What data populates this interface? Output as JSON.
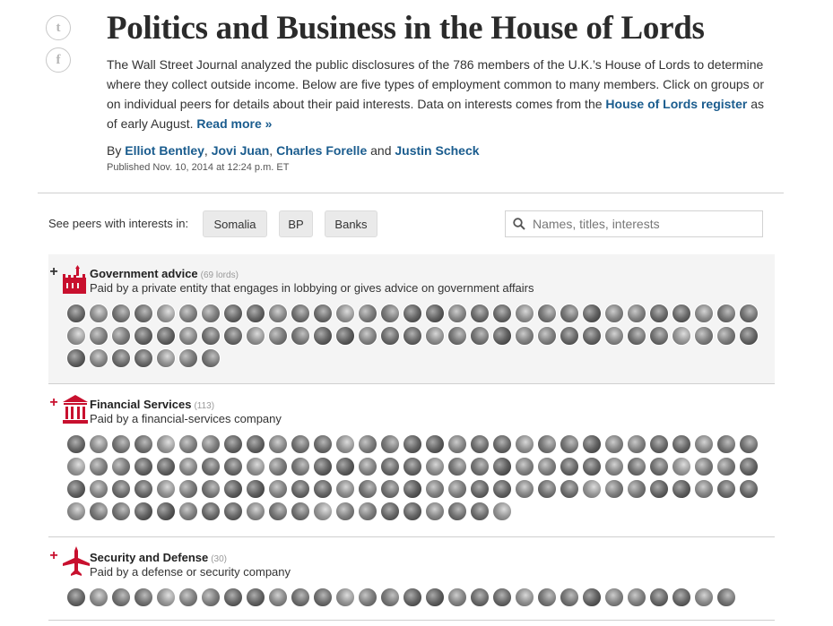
{
  "social": {
    "twitter_glyph": "t",
    "facebook_glyph": "f"
  },
  "header": {
    "title": "Politics and Business in the House of Lords",
    "intro_1": "The Wall Street Journal analyzed the public disclosures of the 786 members of the U.K.’s House of Lords to determine where they collect outside income. Below are five types of employment common to many members. Click on groups or on individual peers for details about their paid interests. Data on interests comes from the ",
    "intro_link": "House of Lords register",
    "intro_2": " as of early August. ",
    "read_more": "Read more »",
    "byline_by": "By ",
    "authors": [
      "Elliot Bentley",
      "Jovi Juan",
      "Charles Forelle",
      "Justin Scheck"
    ],
    "sep_comma": ", ",
    "sep_and": " and ",
    "published": "Published Nov. 10, 2014 at 12:24 p.m. ET"
  },
  "filters": {
    "label": "See peers with interests in:",
    "buttons": [
      "Somalia",
      "BP",
      "Banks"
    ],
    "search_placeholder": "Names, titles, interests"
  },
  "groups": [
    {
      "toggle": "+",
      "name": "Government advice",
      "count": "(69 lords)",
      "description": "Paid by a private entity that engages in lobbying or gives advice on government affairs",
      "faces": 69,
      "icon": "parliament-icon",
      "active": true
    },
    {
      "toggle": "+",
      "name": "Financial Services",
      "count": "(113)",
      "description": "Paid by a financial-services company",
      "faces": 113,
      "icon": "bank-icon",
      "active": false
    },
    {
      "toggle": "+",
      "name": "Security and Defense",
      "count": "(30)",
      "description": "Paid by a defense or security company",
      "faces": 30,
      "icon": "airplane-icon",
      "active": false
    }
  ],
  "colors": {
    "accent_red": "#c8102e",
    "link_blue": "#1a5c8e",
    "toggle_dark": "#333333"
  }
}
